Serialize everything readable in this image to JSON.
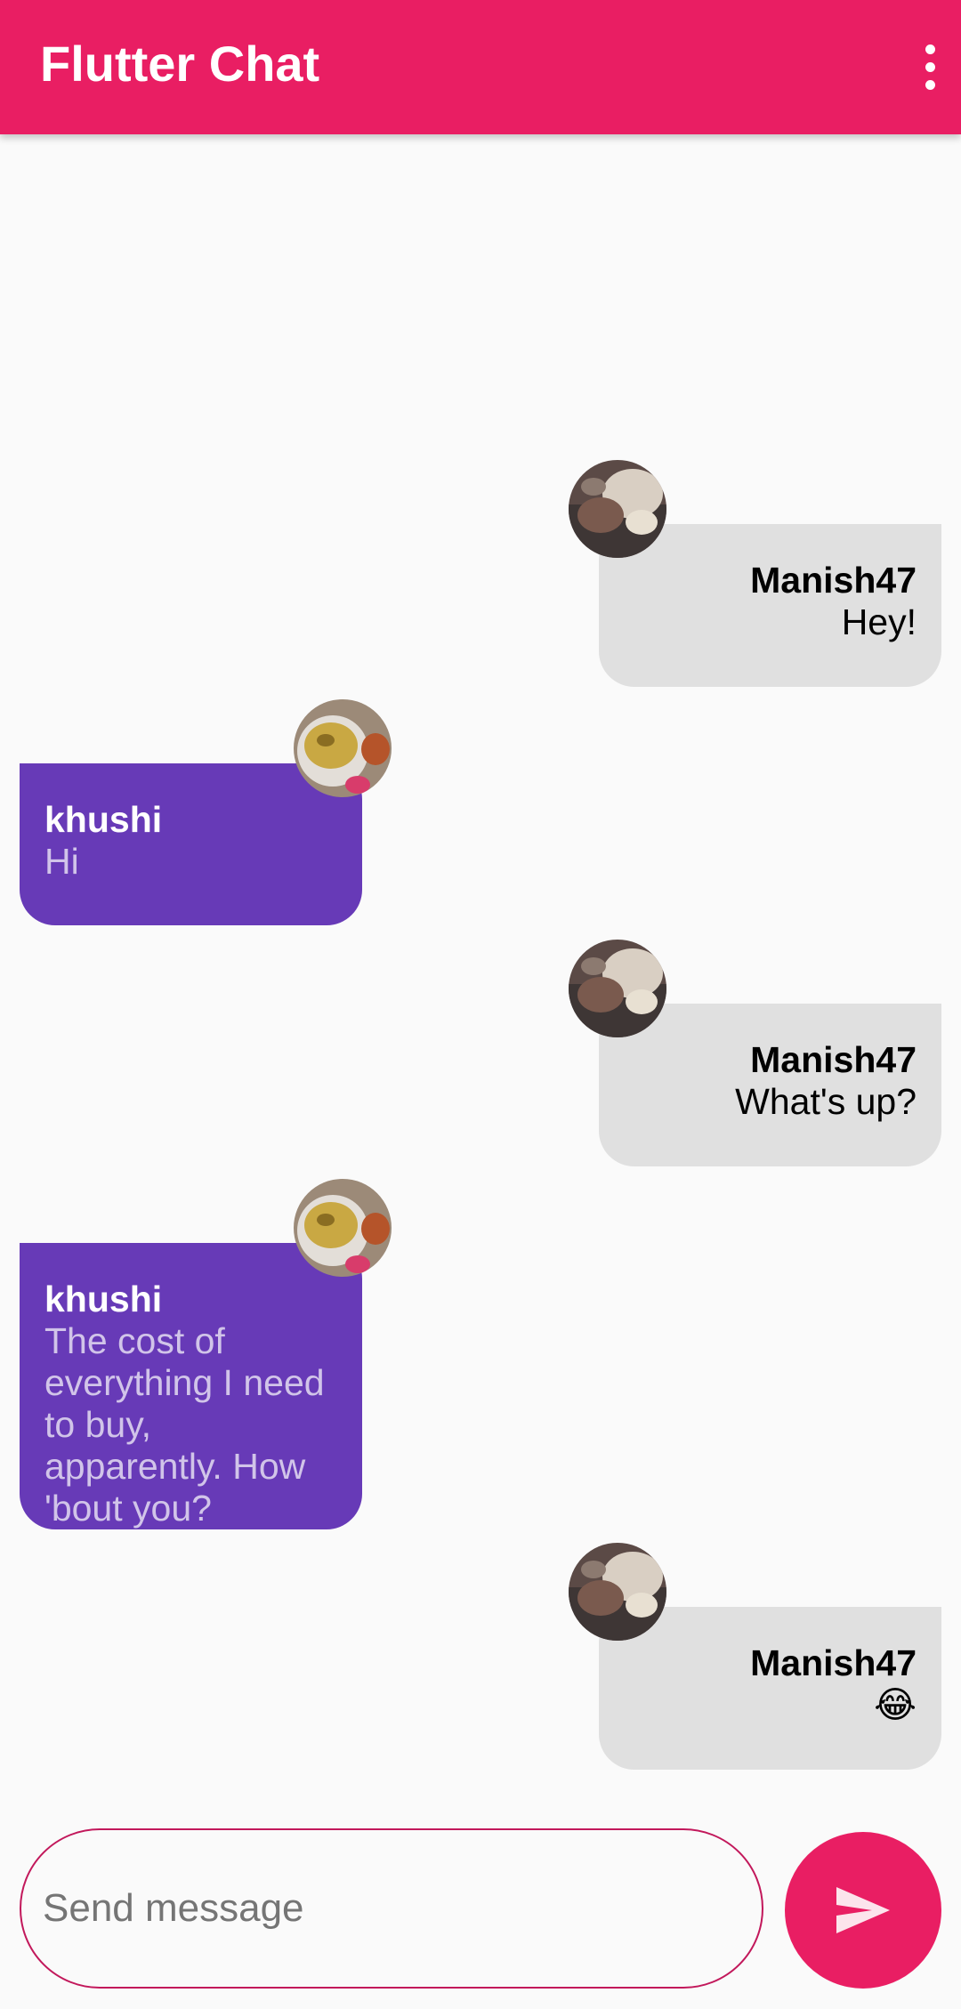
{
  "app": {
    "title": "Flutter Chat",
    "menu_icon": "more-vert-icon"
  },
  "messages": [
    {
      "sender": "Manish47",
      "text": "Hey!",
      "direction": "sent"
    },
    {
      "sender": "khushi",
      "text": "Hi",
      "direction": "received"
    },
    {
      "sender": "Manish47",
      "text": "What's up?",
      "direction": "sent"
    },
    {
      "sender": "khushi",
      "text": "The cost of everything I need to buy, apparently. How 'bout you?",
      "direction": "received"
    },
    {
      "sender": "Manish47",
      "text": "😂",
      "direction": "sent"
    }
  ],
  "composer": {
    "placeholder": "Send message",
    "value": "",
    "send_icon": "send-icon"
  },
  "colors": {
    "primary": "#e91e63",
    "received_bubble": "#673ab7",
    "sent_bubble": "#e0e0e0",
    "background": "#fafafa"
  }
}
